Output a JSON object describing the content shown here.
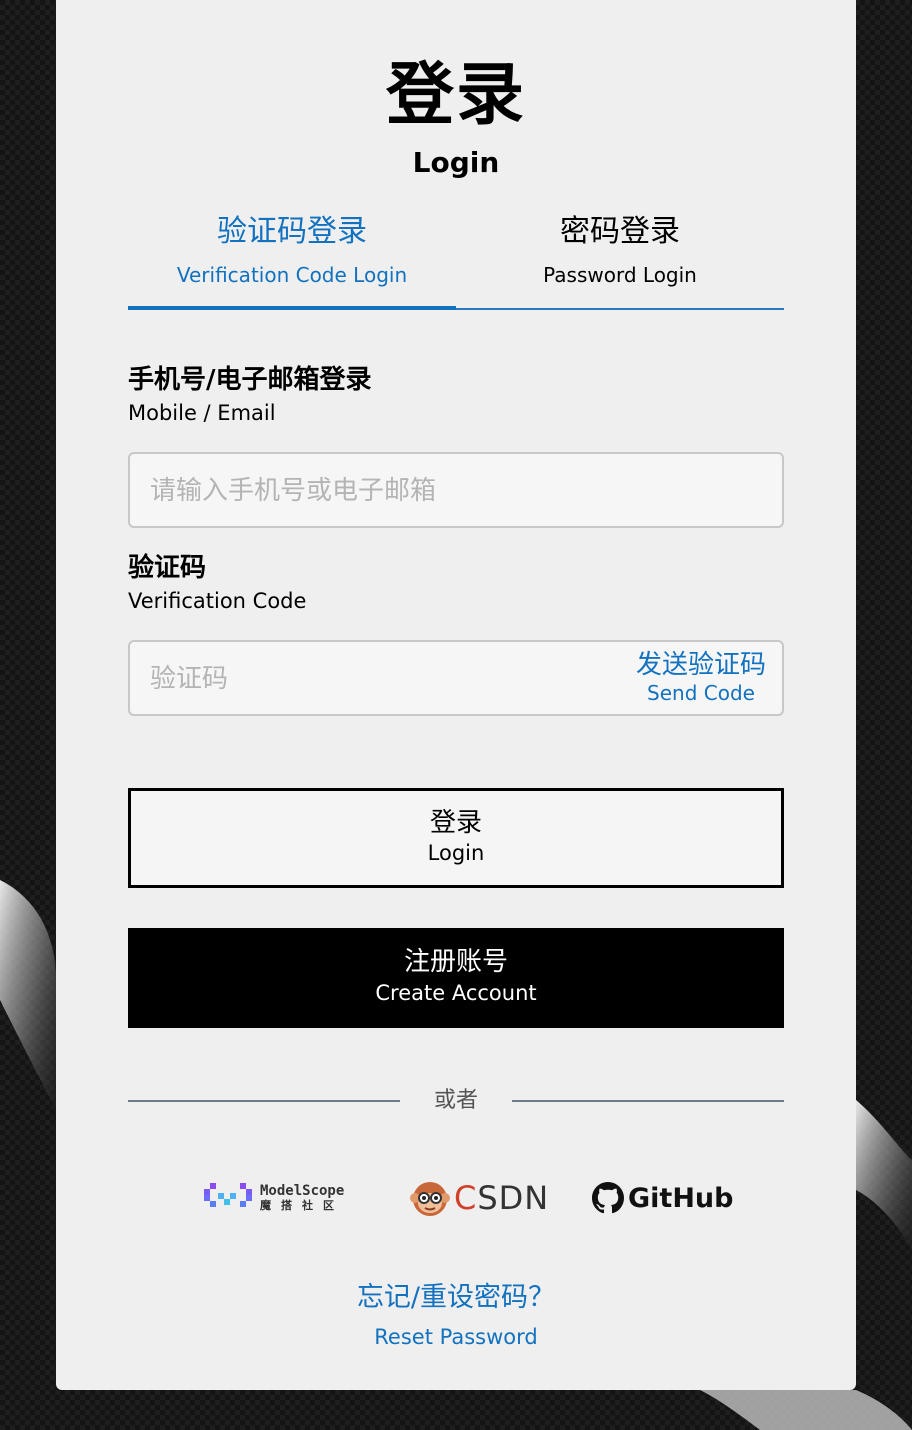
{
  "header": {
    "title_zh": "登录",
    "title_en": "Login"
  },
  "tabs": [
    {
      "label_zh": "验证码登录",
      "label_en": "Verification Code Login",
      "active": true
    },
    {
      "label_zh": "密码登录",
      "label_en": "Password Login",
      "active": false
    }
  ],
  "form": {
    "account": {
      "label_zh": "手机号/电子邮箱登录",
      "label_en": "Mobile / Email",
      "placeholder": "请输入手机号或电子邮箱",
      "value": ""
    },
    "code": {
      "label_zh": "验证码",
      "label_en": "Verification Code",
      "placeholder": "验证码",
      "value": "",
      "send_zh": "发送验证码",
      "send_en": "Send Code"
    }
  },
  "buttons": {
    "login_zh": "登录",
    "login_en": "Login",
    "register_zh": "注册账号",
    "register_en": "Create Account"
  },
  "divider": {
    "text": "或者"
  },
  "social": {
    "modelscope": {
      "name": "ModelScope",
      "subtitle": "魔搭社区"
    },
    "csdn": {
      "c": "C",
      "rest": "SDN"
    },
    "github": {
      "name": "GitHub"
    }
  },
  "reset": {
    "label_zh": "忘记/重设密码？",
    "label_en": "Reset Password"
  },
  "colors": {
    "accent": "#1272c0",
    "card_bg": "#efefef",
    "button_dark": "#000000",
    "csdn_red": "#d0402a"
  }
}
